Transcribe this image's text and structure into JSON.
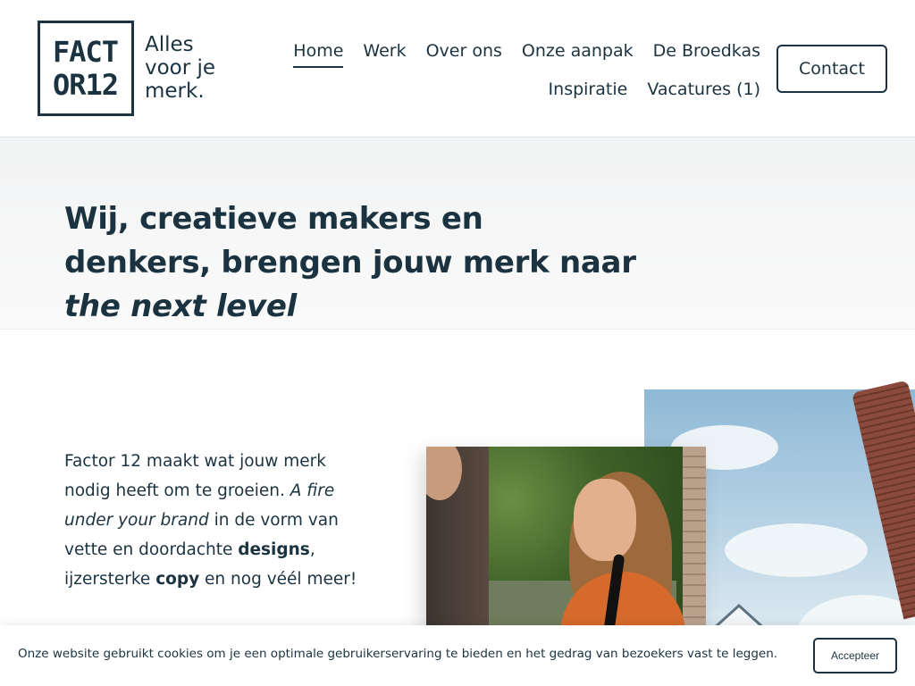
{
  "logo": {
    "line1": "FACT",
    "line2": "OR12",
    "tagline_1": "Alles",
    "tagline_2": "voor je",
    "tagline_3": "merk."
  },
  "nav": {
    "row1": [
      "Home",
      "Werk",
      "Over ons",
      "Onze aanpak",
      "De Broedkas"
    ],
    "row2": [
      "Inspiratie",
      "Vacatures (1)"
    ],
    "active": "Home",
    "contact_label": "Contact"
  },
  "hero": {
    "title_part1": "Wij, creatieve makers en denkers, brengen jouw merk naar ",
    "title_italic": "the next level"
  },
  "intro": {
    "p1": "Factor 12 maakt wat jouw merk nodig heeft om te groeien. ",
    "p2_italic": "A fire under your brand",
    "p3": " in de vorm van vette en doordachte ",
    "p4_bold": "designs",
    "p5": ", ijzersterke ",
    "p6_bold": "copy",
    "p7": " en nog véél meer!"
  },
  "cookie": {
    "text": "Onze website gebruikt cookies om je een optimale gebruikerservaring te bieden en het gedrag van bezoekers vast te leggen.",
    "button_label": "Accepteer"
  },
  "colors": {
    "primary": "#1b3340",
    "hero_bg": "#f4f5f6"
  }
}
